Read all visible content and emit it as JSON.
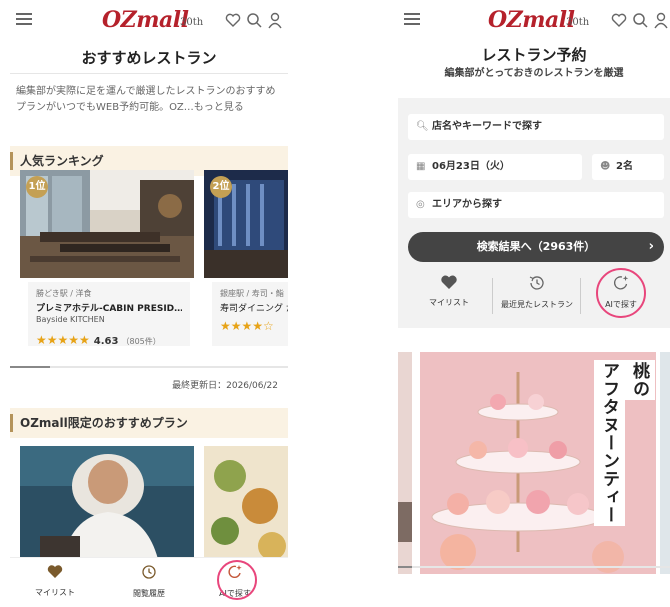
{
  "left": {
    "header": {
      "logo": "OZmall",
      "anniv": "30th"
    },
    "page_title": "おすすめレストラン",
    "intro": "編集部が実際に足を運んで厳選したレストランのおすすめプランがいつでもWEB予約可能。OZ…もっと見る",
    "ranking": {
      "heading": "人気ランキング",
      "cards": [
        {
          "rank": "1位",
          "category": "勝どき駅 / 洋食",
          "name": "プレミアホテル-CABIN PRESID…",
          "sub": "Bayside KITCHEN",
          "stars": "★★★★★",
          "rating": "4.63",
          "count": "（805件）"
        },
        {
          "rank": "2位",
          "category": "銀座駅 / 寿司・鮨",
          "name": "寿司ダイニング か",
          "sub": "",
          "stars": "★★★★☆",
          "rating": "",
          "count": ""
        }
      ],
      "updated": "最終更新日：2026/06/22"
    },
    "plans": {
      "heading": "OZmall限定のおすすめプラン"
    },
    "bottom_nav": [
      {
        "label": "マイリスト",
        "icon": "heart-icon"
      },
      {
        "label": "閲覧履歴",
        "icon": "history-icon"
      },
      {
        "label": "AIで探す",
        "icon": "ai-search-icon"
      }
    ]
  },
  "right": {
    "header": {
      "logo": "OZmall",
      "anniv": "30th"
    },
    "title": "レストラン予約",
    "subtitle": "編集部がとっておきのレストランを厳選",
    "search": {
      "keyword_placeholder": "店名やキーワードで探す",
      "date": "06月23日（火）",
      "people": "2名",
      "area": "エリアから探す",
      "button": "検索結果へ（2963件）"
    },
    "quick": [
      {
        "label": "マイリスト",
        "icon": "heart-icon"
      },
      {
        "label": "最近見たレストラン",
        "icon": "history-icon"
      },
      {
        "label": "AIで探す",
        "icon": "ai-search-icon"
      }
    ],
    "hero": {
      "vertical_1": "アフタヌーンティー",
      "vertical_2": "桃の"
    }
  },
  "colors": {
    "brand": "#b5212b",
    "accent_gold": "#c4a054",
    "highlight_pink": "#e8467c",
    "search_button": "#444444"
  }
}
